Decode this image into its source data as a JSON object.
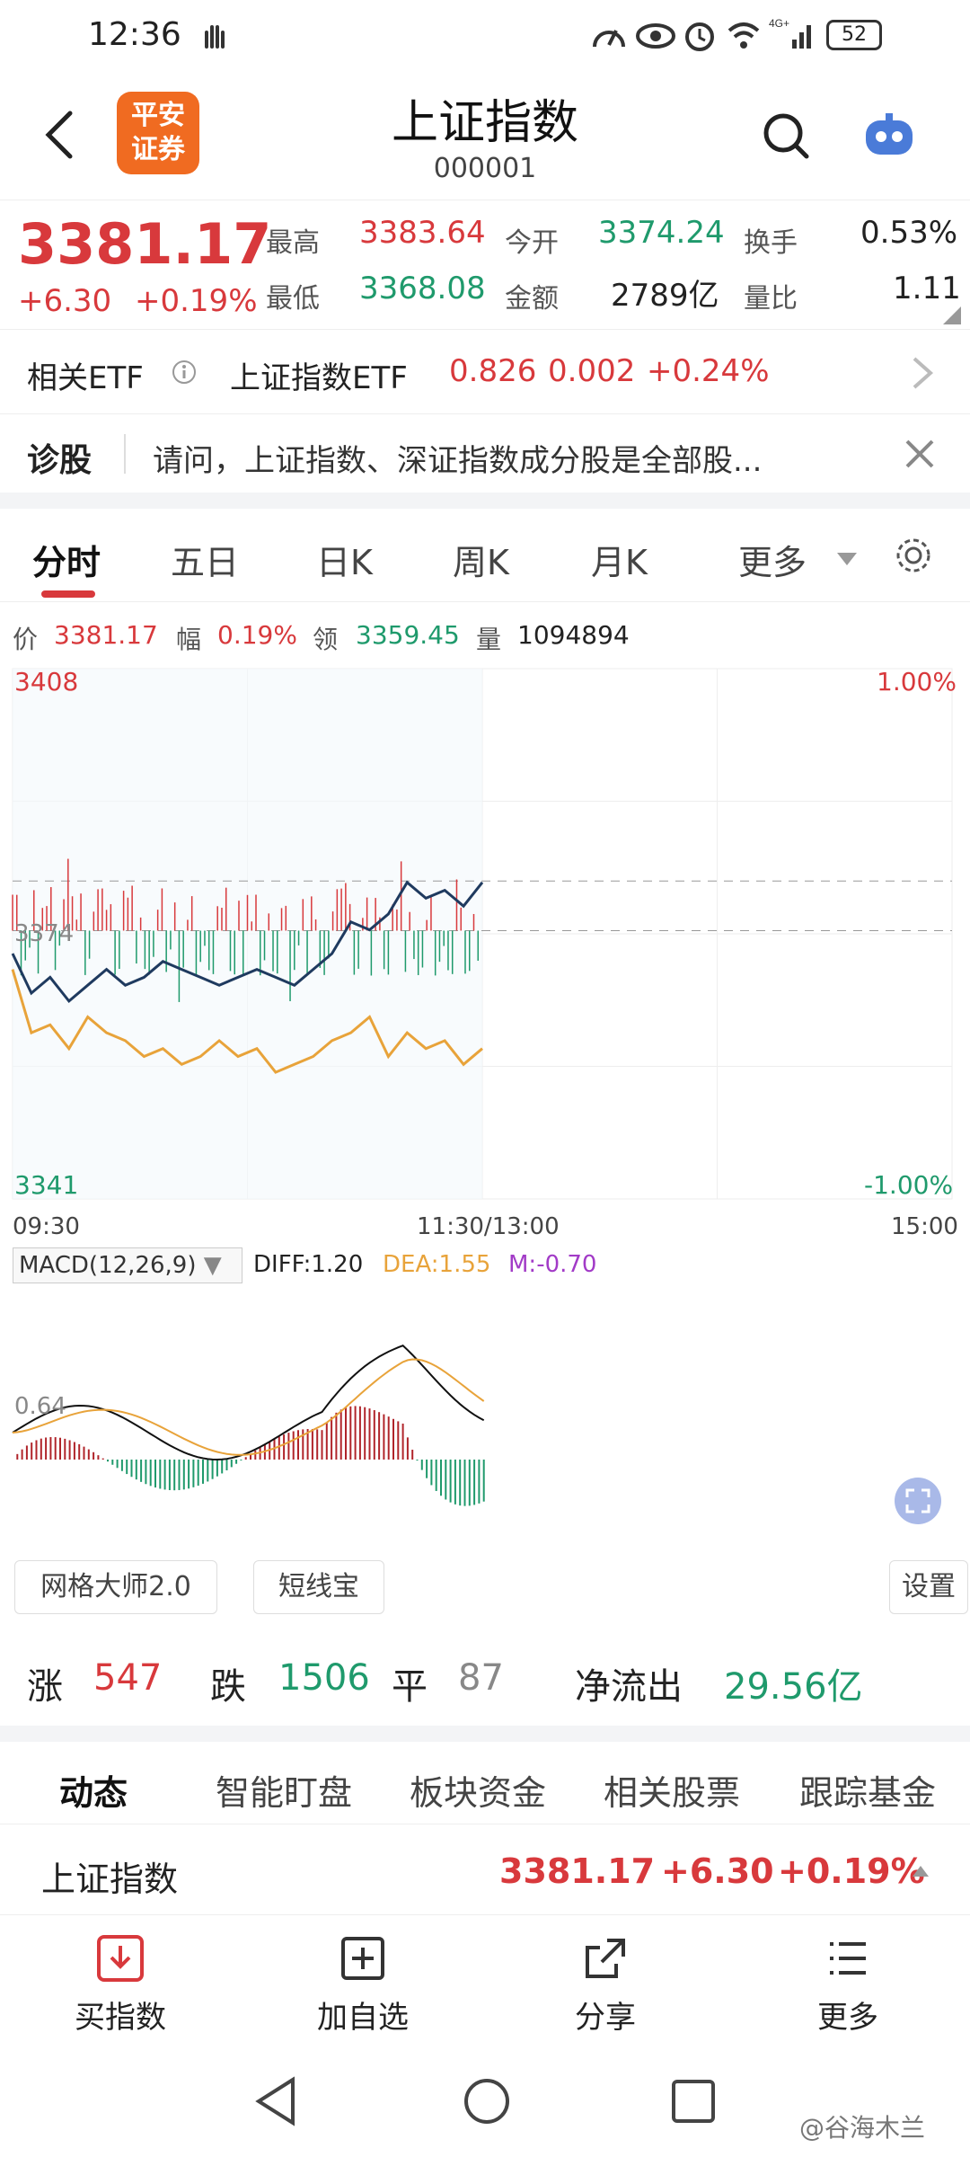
{
  "status": {
    "time": "12:36",
    "battery": "52"
  },
  "nav": {
    "title": "上证指数",
    "code": "000001",
    "logo_line1": "平安",
    "logo_line2": "证券"
  },
  "quote": {
    "price": "3381.17",
    "change": "+6.30",
    "change_pct": "+0.19%",
    "high_label": "最高",
    "high": "3383.64",
    "low_label": "最低",
    "low": "3368.08",
    "open_label": "今开",
    "open": "3374.24",
    "amount_label": "金额",
    "amount": "2789亿",
    "turnover_label": "换手",
    "turnover": "0.53%",
    "vol_ratio_label": "量比",
    "vol_ratio": "1.11"
  },
  "etf": {
    "label": "相关ETF",
    "name": "上证指数ETF",
    "price": "0.826",
    "change": "0.002",
    "pct": "+0.24%"
  },
  "diagnose": {
    "label": "诊股",
    "text": "请问，上证指数、深证指数成分股是全部股..."
  },
  "tabs": [
    "分时",
    "五日",
    "日K",
    "周K",
    "月K",
    "更多"
  ],
  "chart_info": {
    "price_label": "价",
    "price": "3381.17",
    "amp_label": "幅",
    "amp": "0.19%",
    "lead_label": "领",
    "lead": "3359.45",
    "vol_label": "量",
    "vol": "1094894"
  },
  "chart_axes": {
    "y_top": "3408",
    "y_bottom": "3341",
    "y_mid": "3374",
    "pct_top": "1.00%",
    "pct_bottom": "-1.00%",
    "t_start": "09:30",
    "t_mid": "11:30/13:00",
    "t_end": "15:00"
  },
  "macd": {
    "label": "MACD(12,26,9)",
    "diff": "DIFF:1.20",
    "dea": "DEA:1.55",
    "m": "M:-0.70",
    "level": "0.64"
  },
  "tools": {
    "grid": "网格大师2.0",
    "short": "短线宝",
    "settings": "设置"
  },
  "breadth": {
    "up_label": "涨",
    "up": "547",
    "down_label": "跌",
    "down": "1506",
    "flat_label": "平",
    "flat": "87",
    "flow_label": "净流出",
    "flow": "29.56亿"
  },
  "subtabs": [
    "动态",
    "智能盯盘",
    "板块资金",
    "相关股票",
    "跟踪基金"
  ],
  "summary": {
    "name": "上证指数",
    "price": "3381.17",
    "change": "+6.30",
    "pct": "+0.19%"
  },
  "bottom": {
    "buy": "买指数",
    "add": "加自选",
    "share": "分享",
    "more": "更多"
  },
  "watermark": "@谷海木兰",
  "colors": {
    "up": "#d8393c",
    "down": "#1f9a6c",
    "price_line": "#1f3a5f",
    "avg_line": "#e8a33a",
    "macd_m": "#a23bc7"
  },
  "chart_data": {
    "type": "line",
    "ylim": [
      3341,
      3408
    ],
    "x": [
      "09:30",
      "11:30/13:00",
      "15:00"
    ],
    "series": [
      {
        "name": "",
        "values": [
          3372,
          3367,
          3369,
          3366,
          3368,
          3370,
          3368,
          3369,
          3371,
          3370,
          3369,
          3368,
          3369,
          3370,
          3369,
          3368,
          3370,
          3372,
          3376,
          3375,
          3377,
          3381,
          3379,
          3380,
          3378,
          3381
        ]
      },
      {
        "name": "",
        "values": [
          3370,
          3362,
          3363,
          3360,
          3364,
          3362,
          3361,
          3359,
          3360,
          3358,
          3359,
          3361,
          3359,
          3360,
          3357,
          3358,
          3359,
          3361,
          3362,
          3364,
          3359,
          3362,
          3360,
          3361,
          3358,
          3360
        ]
      }
    ]
  }
}
